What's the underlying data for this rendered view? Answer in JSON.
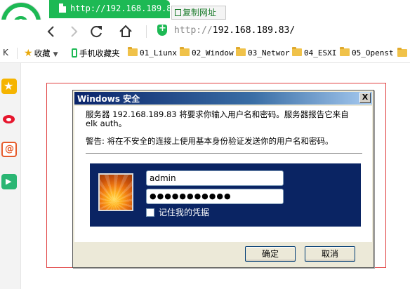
{
  "tab": {
    "title": "http://192.168.189.83/"
  },
  "tooltip": {
    "copy_label": "复制网址"
  },
  "addressbar": {
    "protocol": "http://",
    "host": "192.168.189.83/"
  },
  "bookmarks": {
    "left": "K",
    "items": [
      {
        "label": "收藏",
        "icon": "star-icon"
      },
      {
        "label": "手机收藏夹",
        "icon": "phone-icon"
      },
      {
        "label": "01_Liunx",
        "icon": "folder-icon"
      },
      {
        "label": "02_Window",
        "icon": "folder-icon"
      },
      {
        "label": "03_Networ",
        "icon": "folder-icon"
      },
      {
        "label": "04_ESXI",
        "icon": "folder-icon"
      },
      {
        "label": "05_Openst",
        "icon": "folder-icon"
      }
    ]
  },
  "dialog": {
    "title": "Windows 安全",
    "close": "X",
    "message_line1": "服务器 192.168.189.83 将要求你输入用户名和密码。服务器报告它来自",
    "message_line2": "elk auth。",
    "warning": "警告: 将在不安全的连接上使用基本身份验证发送你的用户名和密码。",
    "username": "admin",
    "password_mask": "●●●●●●●●●●●",
    "remember_label": "记住我的凭据",
    "ok_label": "确定",
    "cancel_label": "取消"
  },
  "colors": {
    "browser_green": "#1db954",
    "dialog_title_start": "#0a246a",
    "cred_panel": "#0a2463",
    "red_frame": "#e04040"
  }
}
